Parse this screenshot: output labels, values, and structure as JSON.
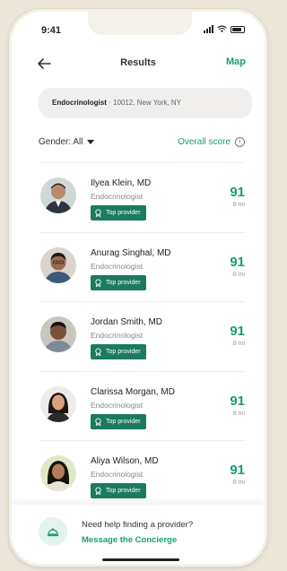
{
  "status_bar": {
    "time": "9:41"
  },
  "header": {
    "title": "Results",
    "map_label": "Map"
  },
  "search": {
    "specialty": "Endocrinologist",
    "location": " · 10012, New York, NY"
  },
  "filters": {
    "gender_label": "Gender: All",
    "sort_label": "Overall score",
    "info_glyph": "i"
  },
  "providers": [
    {
      "name": "Ilyea Klein, MD",
      "specialty": "Endocrinologist",
      "badge": "Top provider",
      "score": "91",
      "distance": ".8 mi"
    },
    {
      "name": "Anurag Singhal, MD",
      "specialty": "Endocrinologist",
      "badge": "Top provider",
      "score": "91",
      "distance": ".8 mi"
    },
    {
      "name": "Jordan Smith, MD",
      "specialty": "Endocrinologist",
      "badge": "Top provider",
      "score": "91",
      "distance": ".8 mi"
    },
    {
      "name": "Clarissa Morgan, MD",
      "specialty": "Endocrinologist",
      "badge": "Top provider",
      "score": "91",
      "distance": ".8 mi"
    },
    {
      "name": "Aliya Wilson, MD",
      "specialty": "Endocrinologist",
      "badge": "Top provider",
      "score": "91",
      "distance": ".8 mi"
    }
  ],
  "footer": {
    "help_text": "Need help finding a provider?",
    "link_label": "Message the Concierge"
  },
  "colors": {
    "accent": "#1b9b78",
    "badge": "#1b7a5f",
    "background": "#ece6da"
  },
  "icons": {
    "back": "arrow-left-icon",
    "badge": "award-icon",
    "concierge": "concierge-bell-icon",
    "info": "info-icon"
  }
}
